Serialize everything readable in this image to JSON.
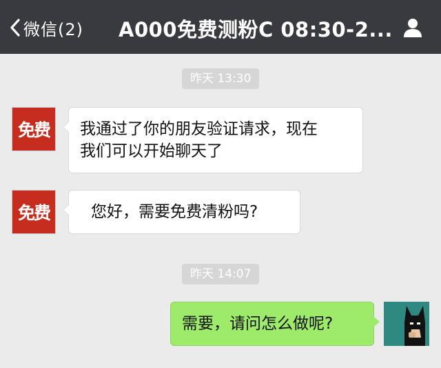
{
  "header": {
    "back_label": "微信(2)",
    "title": "A000免费测粉C 08:30-2..."
  },
  "messages": [
    {
      "type": "timestamp",
      "text": "昨天 13:30"
    },
    {
      "type": "incoming",
      "avatar_text": "免费",
      "text_lines": [
        "我通过了你的朋友验证请求，现在",
        "我们可以开始聊天了"
      ]
    },
    {
      "type": "incoming",
      "avatar_text": "免费",
      "text": "您好，需要免费清粉吗?"
    },
    {
      "type": "timestamp",
      "text": "昨天 14:07"
    },
    {
      "type": "outgoing",
      "text": "需要，请问怎么做呢?"
    }
  ],
  "icons": {
    "back": "chevron-left-icon",
    "profile": "person-icon",
    "my_avatar": "batman-avatar-icon"
  },
  "colors": {
    "header_bg": "#393a3f",
    "chat_bg": "#ebebeb",
    "incoming_bubble": "#ffffff",
    "outgoing_bubble": "#9eea6a",
    "avatar_red": "#c62d1f",
    "timestamp_bg": "#d6d6d6"
  }
}
